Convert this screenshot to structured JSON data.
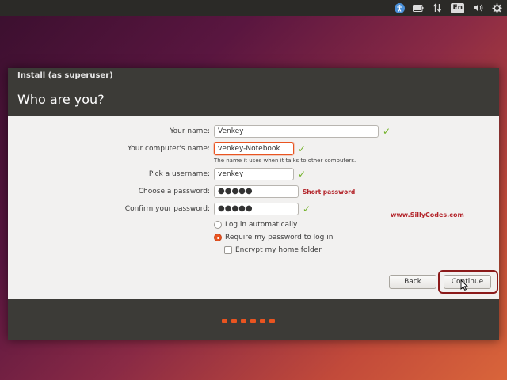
{
  "topbar": {
    "accessibility_icon": "accessibility-icon",
    "battery_icon": "battery-icon",
    "network_icon": "network-arrows-icon",
    "language": "En",
    "volume_icon": "volume-icon",
    "settings_icon": "gear-icon"
  },
  "window": {
    "title": "Install (as superuser)",
    "heading": "Who are you?"
  },
  "form": {
    "name_label": "Your name:",
    "name_value": "Venkey",
    "computer_label": "Your computer's name:",
    "computer_value": "venkey-Notebook",
    "computer_hint": "The name it uses when it talks to other computers.",
    "username_label": "Pick a username:",
    "username_value": "venkey",
    "password_label": "Choose a password:",
    "password_value": "●●●●●",
    "password_strength": "Short password",
    "confirm_label": "Confirm your password:",
    "confirm_value": "●●●●●",
    "options": {
      "log_in_automatically": "Log in automatically",
      "require_password": "Require my password to log in",
      "encrypt_home": "Encrypt my home folder"
    },
    "selected_option": "require_password",
    "check_icon": "checkmark-icon"
  },
  "watermark": "www.SillyCodes.com",
  "buttons": {
    "back": "Back",
    "continue": "Continue"
  },
  "colors": {
    "accent": "#e95420",
    "check": "#73b229",
    "warning": "#b3242a",
    "titlebar": "#3c3b37"
  },
  "progress": {
    "steps_total": 6
  }
}
